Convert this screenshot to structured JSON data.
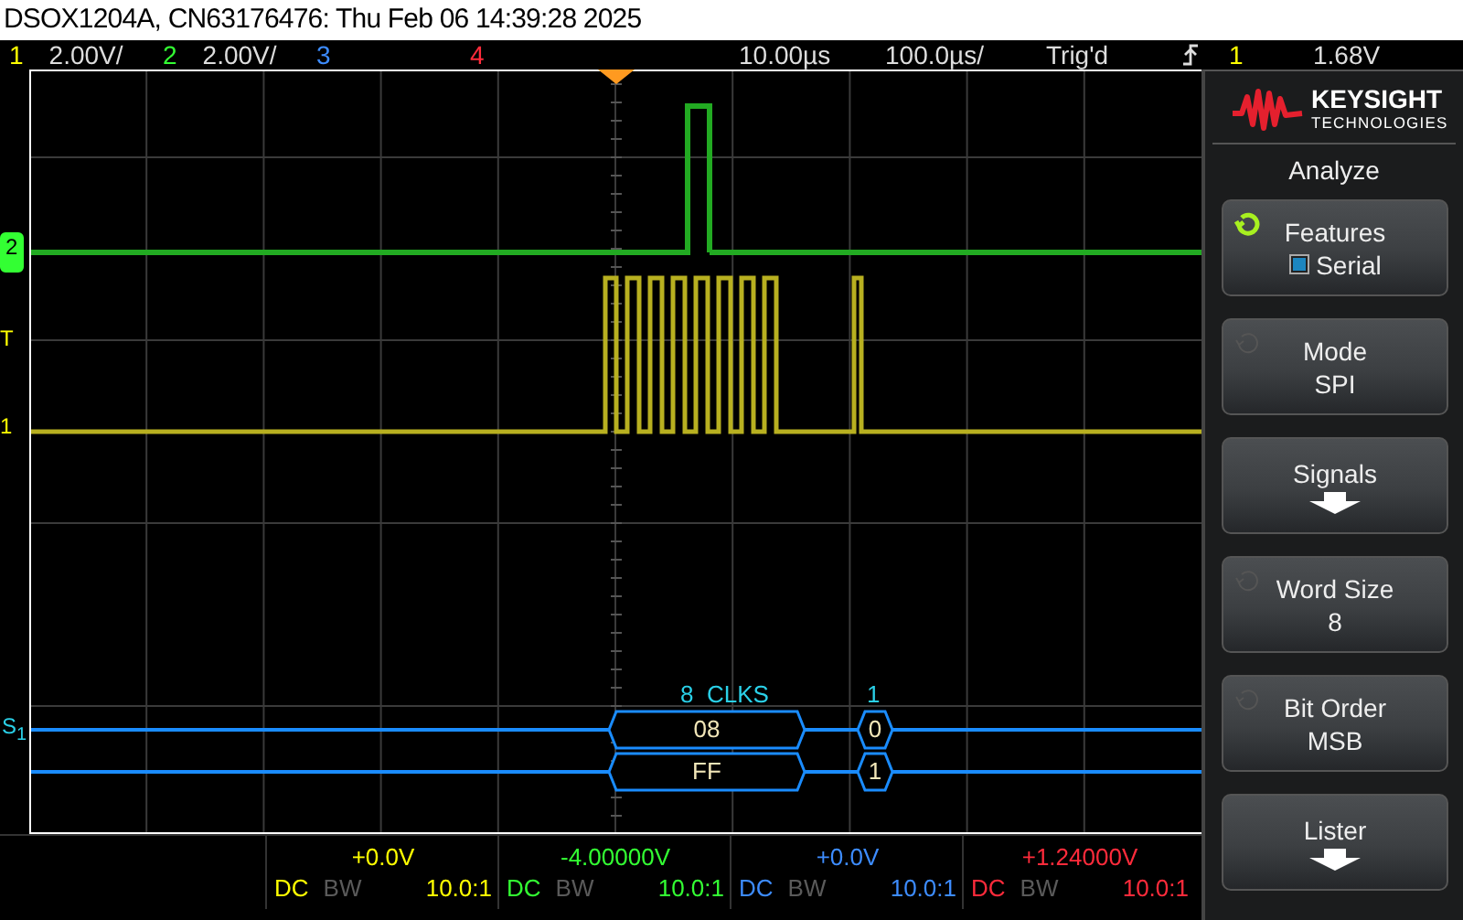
{
  "window": {
    "title": "DSOX1204A, CN63176476: Thu Feb 06 14:39:28 2025"
  },
  "status_bar": {
    "channels": [
      {
        "number": "1",
        "scale": "2.00V/",
        "color": "#ffff00"
      },
      {
        "number": "2",
        "scale": "2.00V/",
        "color": "#33ff33"
      },
      {
        "number": "3",
        "color": "#3d8cff"
      },
      {
        "number": "4",
        "color": "#ff2b3b"
      }
    ],
    "delay": "10.00µs",
    "timebase": "100.0µs/",
    "trigger_status": "Trig'd",
    "trigger_source": "1",
    "trigger_level": "1.68V"
  },
  "markers": [
    {
      "kind": "boxed",
      "text": "2",
      "color": "#33ff33"
    },
    {
      "kind": "trigger",
      "text": "T",
      "color": "#ffff00"
    },
    {
      "kind": "ground",
      "text": "1",
      "color": "#ffff00"
    }
  ],
  "bus": {
    "label": "S$_{1}$",
    "header": [
      "8  CLKS",
      "1"
    ],
    "rows": [
      {
        "packets": [
          "08",
          "0"
        ]
      },
      {
        "packets": [
          "FF",
          "1"
        ]
      }
    ]
  },
  "panel": {
    "logo": {
      "name": "KEYSIGHT",
      "subtitle": "TECHNOLOGIES"
    },
    "title": "Analyze",
    "softkeys": [
      {
        "kind": "checkbox",
        "label": "Features",
        "value": "Serial",
        "checked": true,
        "knob_active": true
      },
      {
        "kind": "value",
        "label": "Mode",
        "value": "SPI",
        "knob_active": false
      },
      {
        "kind": "menu",
        "label": "Signals"
      },
      {
        "kind": "value",
        "label": "Word Size",
        "value": "8",
        "knob_active": false
      },
      {
        "kind": "value",
        "label": "Bit Order",
        "value": "MSB",
        "knob_active": false
      },
      {
        "kind": "menu",
        "label": "Lister"
      }
    ]
  },
  "footer": {
    "channels": [
      {
        "offset": "+0.0V",
        "coupling": "DC",
        "bw": "BW",
        "bw_limit": false,
        "probe": "10.0:1",
        "color": "#ffff00"
      },
      {
        "offset": "-4.00000V",
        "coupling": "DC",
        "bw": "BW",
        "bw_limit": false,
        "probe": "10.0:1",
        "color": "#33ff33"
      },
      {
        "offset": "+0.0V",
        "coupling": "DC",
        "bw": "BW",
        "bw_limit": false,
        "probe": "10.0:1",
        "color": "#3d8cff"
      },
      {
        "offset": "+1.24000V",
        "coupling": "DC",
        "bw": "BW",
        "bw_limit": false,
        "probe": "10.0:1",
        "color": "#ff2b3b"
      }
    ]
  }
}
